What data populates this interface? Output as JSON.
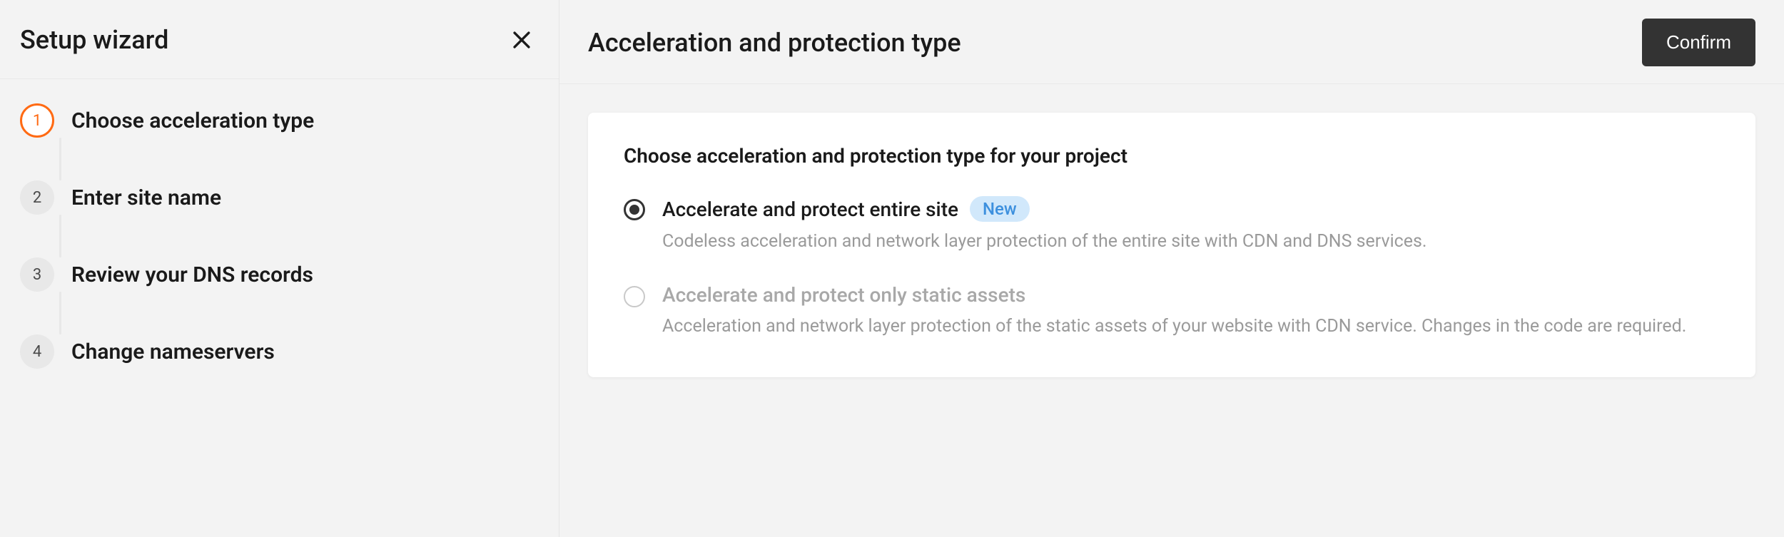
{
  "sidebar": {
    "title": "Setup wizard",
    "steps": [
      {
        "num": "1",
        "label": "Choose acceleration type",
        "active": true
      },
      {
        "num": "2",
        "label": "Enter site name",
        "active": false
      },
      {
        "num": "3",
        "label": "Review your DNS records",
        "active": false
      },
      {
        "num": "4",
        "label": "Change nameservers",
        "active": false
      }
    ]
  },
  "main": {
    "title": "Acceleration and protection type",
    "confirm_label": "Confirm",
    "card": {
      "heading": "Choose acceleration and protection type for your project",
      "options": [
        {
          "title": "Accelerate and protect entire site",
          "badge": "New",
          "desc": "Codeless acceleration and network layer protection of the entire site with CDN and DNS services.",
          "selected": true
        },
        {
          "title": "Accelerate and protect only static assets",
          "badge": null,
          "desc": "Acceleration and network layer protection of the static assets of your website with CDN service. Changes in the code are required.",
          "selected": false
        }
      ]
    }
  }
}
